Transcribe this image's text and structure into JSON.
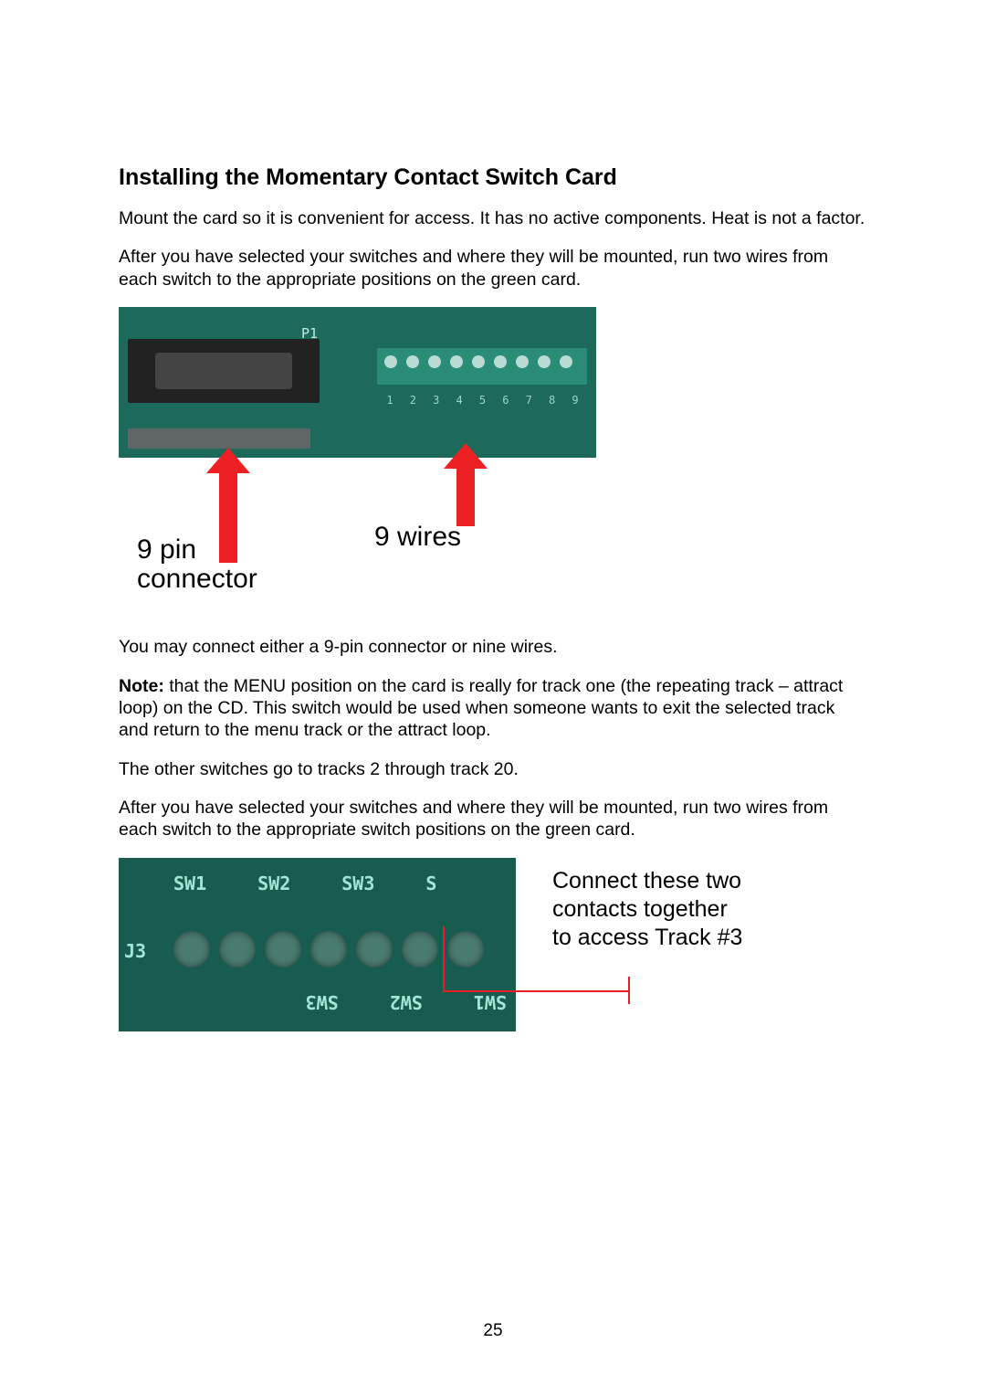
{
  "title": "Installing the Momentary Contact Switch Card",
  "paragraphs": {
    "p1": "Mount the card so it is convenient for access.  It has no active components. Heat is not a factor.",
    "p2": "After you have selected your switches and where they will be mounted, run two wires from each switch to the appropriate positions on the green card.",
    "p3": "You may connect either a 9-pin connector or nine wires.",
    "note_label": "Note:",
    "note_body": " that the MENU position on the card is really for track one (the repeating track – attract loop) on the CD. This switch would be used when someone wants to exit the selected track and return to the menu track or the attract loop.",
    "p4": "The other switches go to tracks 2 through track 20.",
    "p5": "After you have selected your switches and where they will be mounted, run two wires from each switch to the appropriate switch positions on the green card."
  },
  "figure1": {
    "p1_marker": "P1",
    "label_left": "9 pin\nconnector",
    "label_right": "9 wires",
    "terminal_numbers": [
      "1",
      "2",
      "3",
      "4",
      "5",
      "6",
      "7",
      "8",
      "9"
    ]
  },
  "figure2": {
    "top_labels": [
      "SW1",
      "SW2",
      "SW3",
      "S"
    ],
    "j3": "J3",
    "bottom_labels_mirror": [
      "SW1",
      "SW2",
      "SW3"
    ],
    "callout_line1": "Connect these two",
    "callout_line2": "contacts together",
    "callout_line3": "to access Track #3"
  },
  "page_number": "25"
}
